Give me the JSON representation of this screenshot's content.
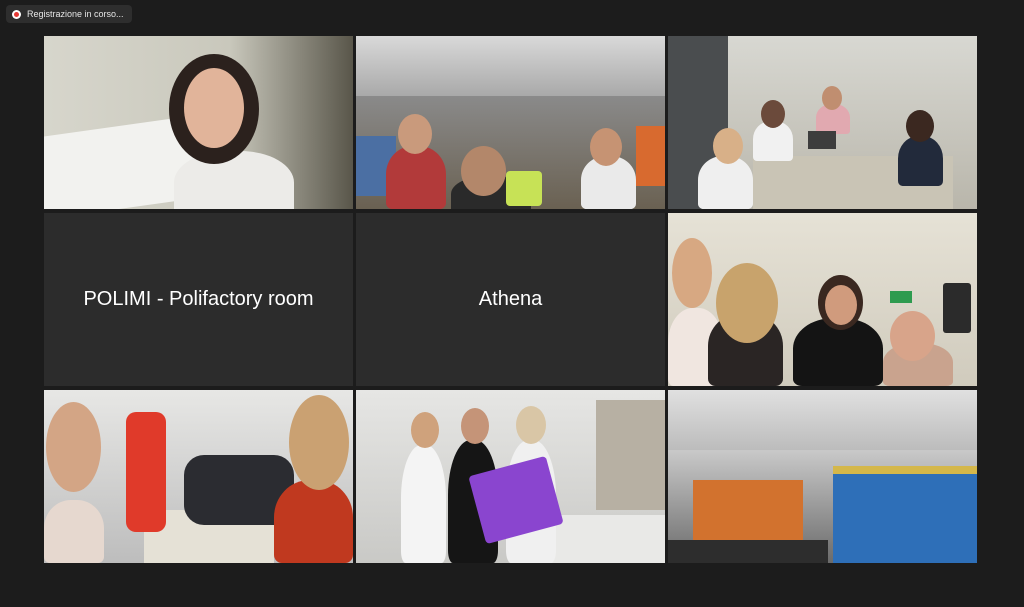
{
  "recording": {
    "label": "Registrazione in corso...",
    "colors": {
      "dot": "#e53935"
    }
  },
  "tiles": [
    {
      "type": "video",
      "scene": "woman holding white paper at home"
    },
    {
      "type": "video",
      "scene": "group in lab with masks"
    },
    {
      "type": "video",
      "scene": "meeting room with laptops"
    },
    {
      "type": "name",
      "name": "POLIMI - Polifactory room"
    },
    {
      "type": "name",
      "name": "Athena"
    },
    {
      "type": "video",
      "scene": "four women smiling",
      "active": true
    },
    {
      "type": "video",
      "scene": "two women with red and black objects"
    },
    {
      "type": "video",
      "scene": "three women with purple object"
    },
    {
      "type": "video",
      "scene": "empty lab with blue lockers"
    }
  ],
  "colors": {
    "background": "#1c1c1c",
    "tile_name_bg": "#2c2c2c",
    "active_speaker": "#d9e64a"
  }
}
